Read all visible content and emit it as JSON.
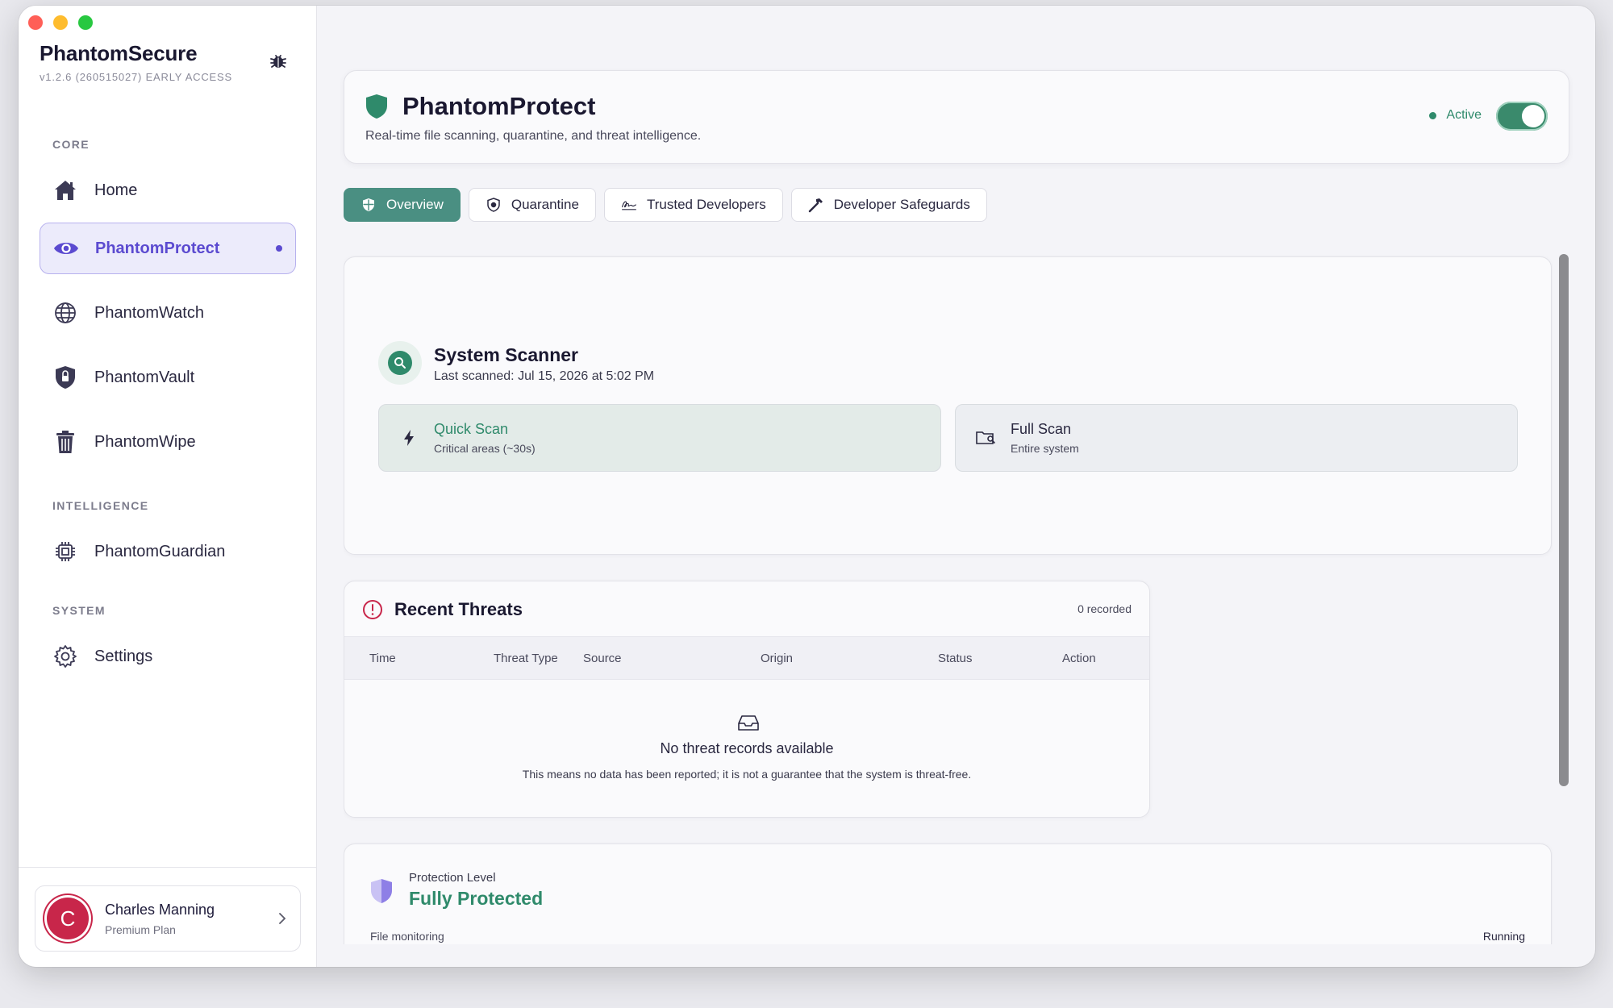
{
  "app": {
    "name": "PhantomSecure",
    "version": "v1.2.6 (260515027) EARLY ACCESS"
  },
  "sidebar": {
    "sections": {
      "core": "CORE",
      "intelligence": "INTELLIGENCE",
      "system": "SYSTEM"
    },
    "items": [
      {
        "label": "Home",
        "icon": "home-icon"
      },
      {
        "label": "PhantomProtect",
        "icon": "eye-icon",
        "active": true
      },
      {
        "label": "PhantomWatch",
        "icon": "globe-icon"
      },
      {
        "label": "PhantomVault",
        "icon": "shield-lock-icon"
      },
      {
        "label": "PhantomWipe",
        "icon": "trash-icon"
      },
      {
        "label": "PhantomGuardian",
        "icon": "chip-icon"
      },
      {
        "label": "Settings",
        "icon": "gear-icon"
      }
    ]
  },
  "user": {
    "initial": "C",
    "name": "Charles Manning",
    "plan": "Premium Plan"
  },
  "header": {
    "title": "PhantomProtect",
    "subtitle": "Real-time file scanning, quarantine, and threat intelligence.",
    "status": "Active",
    "enabled": true
  },
  "tabs": [
    {
      "label": "Overview",
      "icon": "shield-icon",
      "active": true
    },
    {
      "label": "Quarantine",
      "icon": "shield-badge-icon"
    },
    {
      "label": "Trusted Developers",
      "icon": "signature-icon"
    },
    {
      "label": "Developer Safeguards",
      "icon": "hammer-icon"
    }
  ],
  "scanner": {
    "title": "System Scanner",
    "last_scanned": "Last scanned: Jul 15, 2026 at 5:02 PM",
    "quick": {
      "title": "Quick Scan",
      "sub": "Critical areas (~30s)"
    },
    "full": {
      "title": "Full Scan",
      "sub": "Entire system"
    }
  },
  "threats": {
    "title": "Recent Threats",
    "count": "0 recorded",
    "columns": [
      "Time",
      "Threat Type",
      "Source",
      "Origin",
      "Status",
      "Action"
    ],
    "empty_title": "No threat records available",
    "empty_sub": "This means no data has been reported; it is not a guarantee that the system is threat-free."
  },
  "protection": {
    "label": "Protection Level",
    "value": "Fully Protected",
    "monitor_label": "File monitoring",
    "monitor_value": "Running"
  },
  "colors": {
    "accent": "#5b4ad0",
    "success": "#2f8a6b",
    "tab_active": "#4a8f82",
    "alert": "#c8264a"
  }
}
